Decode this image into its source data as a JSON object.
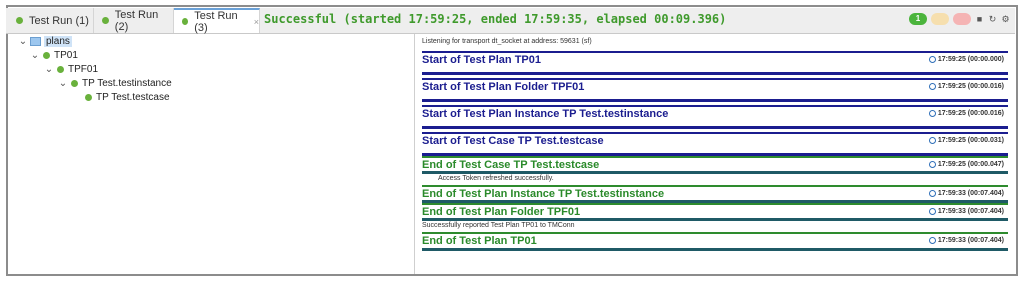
{
  "tabs": [
    {
      "label": "Test Run (1)"
    },
    {
      "label": "Test Run (2)"
    },
    {
      "label": "Test Run (3)",
      "close": "×"
    }
  ],
  "status": "Successful (started 17:59:25, ended 17:59:35, elapsed 00:09.396)",
  "indicators": {
    "passed": "1",
    "warnings": "",
    "failures": ""
  },
  "toolbar_icons": [
    "stop-icon",
    "refresh-icon",
    "settings-icon"
  ],
  "tree": [
    {
      "label": "plans",
      "icon": "folder-icon"
    },
    {
      "label": "TP01",
      "icon": "status-dot-icon"
    },
    {
      "label": "TPF01",
      "icon": "status-dot-icon"
    },
    {
      "label": "TP Test.testinstance",
      "icon": "status-dot-icon"
    },
    {
      "label": "TP Test.testcase",
      "icon": "status-dot-icon"
    }
  ],
  "log": {
    "listening": "Listening for transport dt_socket at address: 59631 (sf)",
    "entries": [
      {
        "title": "Start of Test Plan TP01",
        "time": "17:59:25 (00:00.000)",
        "status": "start"
      },
      {
        "title": "Start of Test Plan Folder TPF01",
        "time": "17:59:25 (00:00.016)",
        "status": "start"
      },
      {
        "title": "Start of Test Plan Instance TP Test.testinstance",
        "time": "17:59:25 (00:00.016)",
        "status": "start"
      },
      {
        "title": "Start of Test Case TP Test.testcase",
        "time": "17:59:25 (00:00.031)",
        "status": "start"
      },
      {
        "title": "End of Test Case TP Test.testcase",
        "time": "17:59:25 (00:00.047)",
        "status": "end"
      },
      {
        "title": "End of Test Plan Instance TP Test.testinstance",
        "time": "17:59:33 (00:07.404)",
        "status": "end"
      },
      {
        "title": "End of Test Plan Folder TPF01",
        "time": "17:59:33 (00:07.404)",
        "status": "end"
      },
      {
        "title": "End of Test Plan TP01",
        "time": "17:59:33 (00:07.404)",
        "status": "end"
      }
    ],
    "notes": [
      "Access Token refreshed successfully.",
      "Successfully reported Test Plan TP01 to TMConn"
    ]
  },
  "colors": {
    "start": "#1b1d8f",
    "end": "#2a8a2a",
    "success": "#3f9a2c"
  }
}
